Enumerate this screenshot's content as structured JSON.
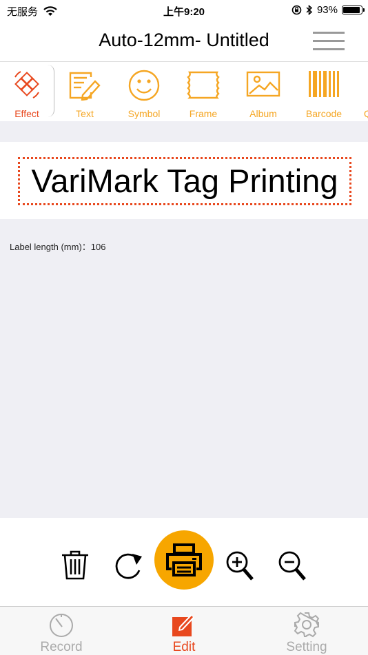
{
  "status": {
    "carrier": "无服务",
    "time": "上午9:20",
    "battery": "93%",
    "battery_level": 0.93
  },
  "header": {
    "title": "Auto-12mm- Untitled"
  },
  "toolbar": {
    "items": [
      {
        "label": "Effect",
        "icon": "effect-icon"
      },
      {
        "label": "Text",
        "icon": "text-edit-icon"
      },
      {
        "label": "Symbol",
        "icon": "smiley-icon"
      },
      {
        "label": "Frame",
        "icon": "frame-icon"
      },
      {
        "label": "Album",
        "icon": "image-icon"
      },
      {
        "label": "Barcode",
        "icon": "barcode-icon"
      },
      {
        "label": "Q",
        "icon": "partial"
      }
    ]
  },
  "canvas": {
    "label_text": "VariMark Tag Printing"
  },
  "label_length": "Label length (mm)：106",
  "actions": {
    "delete": "trash-icon",
    "rotate": "rotate-icon",
    "print": "printer-icon",
    "zoom_in": "zoom-in-icon",
    "zoom_out": "zoom-out-icon"
  },
  "tabs": [
    {
      "label": "Record",
      "icon": "stopwatch-icon"
    },
    {
      "label": "Edit",
      "icon": "edit-icon"
    },
    {
      "label": "Setting",
      "icon": "gear-icon"
    }
  ],
  "colors": {
    "accent": "#e8481e",
    "tool": "#f5a623",
    "print": "#f7a600"
  }
}
